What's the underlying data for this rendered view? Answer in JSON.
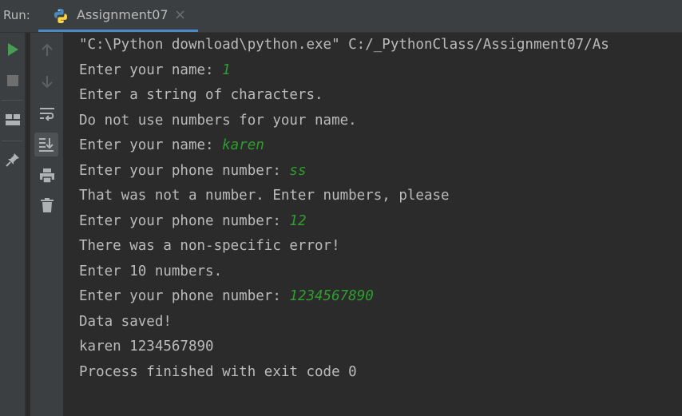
{
  "tabbar": {
    "run_label": "Run:",
    "tab_title": "Assignment07",
    "close_glyph": "×",
    "tab_icon": "python-icon"
  },
  "toolbar": {
    "left": [
      {
        "name": "rerun-icon",
        "color": "#499c54"
      },
      {
        "name": "stop-icon",
        "color": "#6e6e6e"
      },
      {
        "name": "layout-icon",
        "color": "#afb1b3"
      },
      {
        "name": "pin-icon",
        "color": "#afb1b3"
      }
    ],
    "right": [
      {
        "name": "up-arrow-icon"
      },
      {
        "name": "down-arrow-icon"
      },
      {
        "name": "soft-wrap-icon"
      },
      {
        "name": "scroll-to-end-icon"
      },
      {
        "name": "print-icon"
      },
      {
        "name": "trash-icon"
      }
    ]
  },
  "console": {
    "lines": [
      {
        "text": "\"C:\\Python download\\python.exe\" C:/_PythonClass/Assignment07/As",
        "input": ""
      },
      {
        "text": "Enter your name: ",
        "input": "1"
      },
      {
        "text": "Enter a string of characters.",
        "input": ""
      },
      {
        "text": "Do not use numbers for your name.",
        "input": ""
      },
      {
        "text": "Enter your name: ",
        "input": "karen"
      },
      {
        "text": "Enter your phone number: ",
        "input": "ss"
      },
      {
        "text": "That was not a number. Enter numbers, please",
        "input": ""
      },
      {
        "text": "Enter your phone number: ",
        "input": "12"
      },
      {
        "text": "There was a non-specific error!",
        "input": ""
      },
      {
        "text": "Enter 10 numbers.",
        "input": ""
      },
      {
        "text": "Enter your phone number: ",
        "input": "1234567890"
      },
      {
        "text": "Data saved!",
        "input": ""
      },
      {
        "text": "karen 1234567890",
        "input": ""
      },
      {
        "text": "Process finished with exit code 0",
        "input": ""
      }
    ]
  },
  "colors": {
    "background": "#2b2b2b",
    "panel": "#3c3f41",
    "text": "#bbbbbb",
    "user_input": "#2e9e2e",
    "tab_underline": "#4a88c7"
  }
}
